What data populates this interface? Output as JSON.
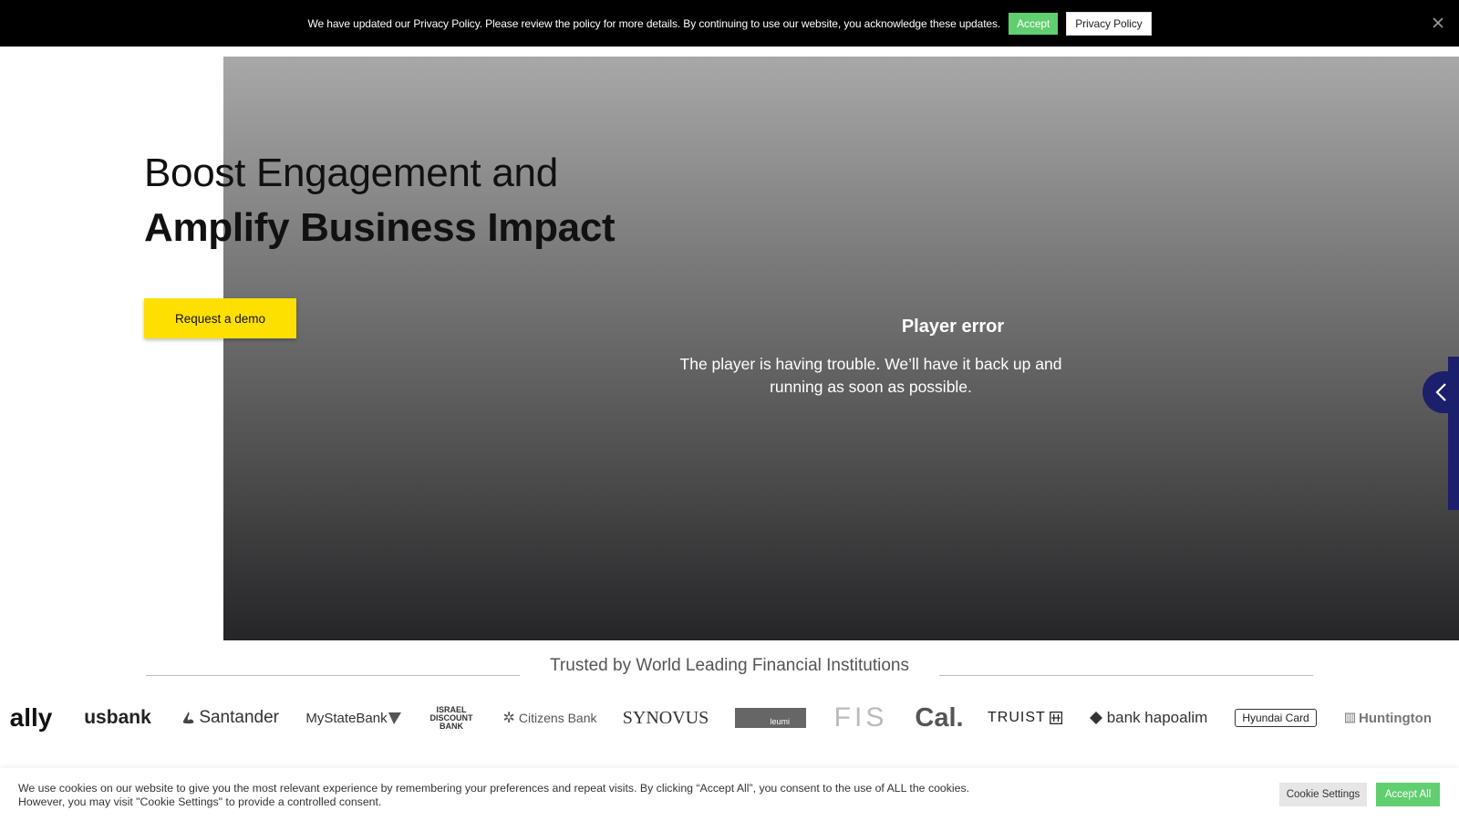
{
  "privacy_bar": {
    "message": "We have updated our Privacy Policy. Please review the policy for more details. By continuing to use our website, you acknowledge these updates.",
    "accept_label": "Accept",
    "policy_label": "Privacy Policy",
    "close_icon": "close-icon"
  },
  "hero": {
    "title_line1": "Boost Engagement and",
    "title_line2": "Amplify Business Impact",
    "cta_label": "Request a demo"
  },
  "video_player": {
    "error_title": "Player error",
    "error_message": "The player is having trouble. We’ll have it back up and running as soon as possible."
  },
  "trusted": {
    "title": "Trusted by World Leading Financial Institutions",
    "logos": [
      {
        "name": "ally"
      },
      {
        "name": "usbank"
      },
      {
        "name": "Santander"
      },
      {
        "name": "MyStateBank"
      },
      {
        "name": "ISRAEL DISCOUNT BANK"
      },
      {
        "name": "Citizens Bank"
      },
      {
        "name": "SYNOVUS"
      },
      {
        "name": "leumi"
      },
      {
        "name": "FIS"
      },
      {
        "name": "Cal."
      },
      {
        "name": "TRUIST"
      },
      {
        "name": "bank hapoalim"
      },
      {
        "name": "Hyundai Card"
      },
      {
        "name": "Huntington"
      }
    ]
  },
  "cookie_bar": {
    "message": "We use cookies on our website to give you the most relevant experience by remembering your preferences and repeat visits. By clicking “Accept All”, you consent to the use of ALL the cookies. However, you may visit \"Cookie Settings\" to provide a controlled consent.",
    "settings_label": "Cookie Settings",
    "accept_all_label": "Accept All"
  },
  "colors": {
    "accent_green": "#61ce70",
    "cta_yellow": "#fde000",
    "side_tab_navy": "#1c1f6b"
  }
}
